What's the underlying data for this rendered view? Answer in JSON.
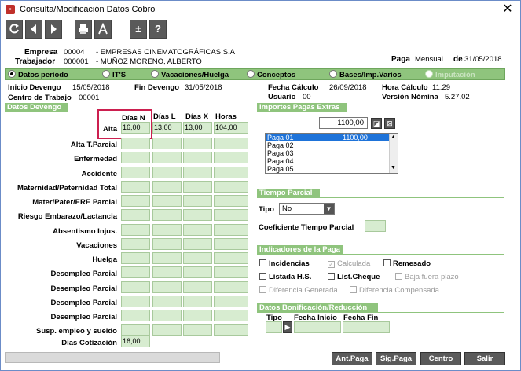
{
  "window": {
    "title": "Consulta/Modificación Datos Cobro"
  },
  "toolbar": {
    "buttons": [
      {
        "name": "refresh-button",
        "icon": "refresh-icon"
      },
      {
        "name": "prev-button",
        "icon": "arrow-left-icon"
      },
      {
        "name": "next-button",
        "icon": "arrow-right-icon"
      },
      {
        "name": "print-button",
        "icon": "print-icon"
      },
      {
        "name": "pdf-button",
        "icon": "pdf-icon"
      },
      {
        "name": "plus-minus-button",
        "icon": "plus-minus-icon",
        "label": "±"
      },
      {
        "name": "help-button",
        "icon": "help-icon",
        "label": "?"
      }
    ]
  },
  "header": {
    "empresa_label": "Empresa",
    "empresa_code": "00004",
    "empresa_name": "- EMPRESAS CINEMATOGRÁFICAS S.A",
    "trabajador_label": "Trabajador",
    "trabajador_code": "000001",
    "trabajador_name": "- MUÑOZ MORENO, ALBERTO",
    "paga_label": "Paga",
    "paga_value": "Mensual",
    "de_label": "de",
    "de_value": "31/05/2018"
  },
  "tabs": [
    {
      "label": "Datos período",
      "selected": true,
      "disabled": false
    },
    {
      "label": "IT'S",
      "selected": false,
      "disabled": false
    },
    {
      "label": "Vacaciones/Huelga",
      "selected": false,
      "disabled": false
    },
    {
      "label": "Conceptos",
      "selected": false,
      "disabled": false
    },
    {
      "label": "Bases/Imp.Varios",
      "selected": false,
      "disabled": false
    },
    {
      "label": "Imputación",
      "selected": false,
      "disabled": true
    }
  ],
  "info": {
    "inicio_label": "Inicio Devengo",
    "inicio_value": "15/05/2018",
    "fin_label": "Fin Devengo",
    "fin_value": "31/05/2018",
    "fecha_calc_label": "Fecha Cálculo",
    "fecha_calc_value": "26/09/2018",
    "hora_calc_label": "Hora Cálculo",
    "hora_calc_value": "11:29",
    "centro_label": "Centro de Trabajo",
    "centro_value": "00001",
    "usuario_label": "Usuario",
    "usuario_value": "00",
    "version_label": "Versión Nómina",
    "version_value": "5.27.02"
  },
  "devengo": {
    "title": "Datos Devengo",
    "columns": [
      "Días N",
      "Días L",
      "Días X",
      "Horas"
    ],
    "alta": {
      "label": "Alta",
      "values": [
        "16,00",
        "13,00",
        "13,00",
        "104,00"
      ]
    },
    "rows": [
      "Alta T.Parcial",
      "Enfermedad",
      "Accidente",
      "Maternidad/Paternidad Total",
      "Mater/Pater/ERE Parcial",
      "Riesgo Embarazo/Lactancia",
      "Absentismo Injus.",
      "Vacaciones",
      "Huelga",
      "Desempleo Parcial",
      "Desempleo Parcial",
      "Desempleo Parcial",
      "Desempleo Parcial",
      "Susp. empleo y sueldo"
    ],
    "dias_cot_label": "Días Cotización",
    "dias_cot_value": "16,00"
  },
  "pagas_extras": {
    "title": "Importes Pagas Extras",
    "amount": "1100,00",
    "items": [
      {
        "label": "Paga 01",
        "amount": "1100,00",
        "selected": true
      },
      {
        "label": "Paga 02",
        "amount": "",
        "selected": false
      },
      {
        "label": "Paga 03",
        "amount": "",
        "selected": false
      },
      {
        "label": "Paga 04",
        "amount": "",
        "selected": false
      },
      {
        "label": "Paga 05",
        "amount": "",
        "selected": false
      }
    ]
  },
  "tiempo_parcial": {
    "title": "Tiempo Parcial",
    "tipo_label": "Tipo",
    "tipo_value": "No",
    "coef_label": "Coeficiente Tiempo Parcial"
  },
  "indicadores": {
    "title": "Indicadores de la Paga",
    "items": [
      {
        "label": "Incidencias",
        "checked": false,
        "disabled": false
      },
      {
        "label": "Calculada",
        "checked": true,
        "disabled": true
      },
      {
        "label": "Remesado",
        "checked": false,
        "disabled": false
      },
      {
        "label": "Listada H.S.",
        "checked": false,
        "disabled": false
      },
      {
        "label": "List.Cheque",
        "checked": false,
        "disabled": false
      },
      {
        "label": "Baja fuera plazo",
        "checked": false,
        "disabled": true
      },
      {
        "label": "Diferencia Generada",
        "checked": false,
        "disabled": true
      },
      {
        "label": "Diferencia Compensada",
        "checked": false,
        "disabled": true
      }
    ]
  },
  "bonificacion": {
    "title": "Datos Bonificación/Reducción",
    "col_tipo": "Tipo",
    "col_inicio": "Fecha Inicio",
    "col_fin": "Fecha Fin"
  },
  "footer": {
    "ant_paga": "Ant.Paga",
    "sig_paga": "Sig.Paga",
    "centro": "Centro",
    "salir": "Salir"
  },
  "colors": {
    "section_green": "#8fc47d",
    "cell_green": "#d7ecd0",
    "highlight": "#cc1f4f",
    "selection_blue": "#1e73d9"
  }
}
